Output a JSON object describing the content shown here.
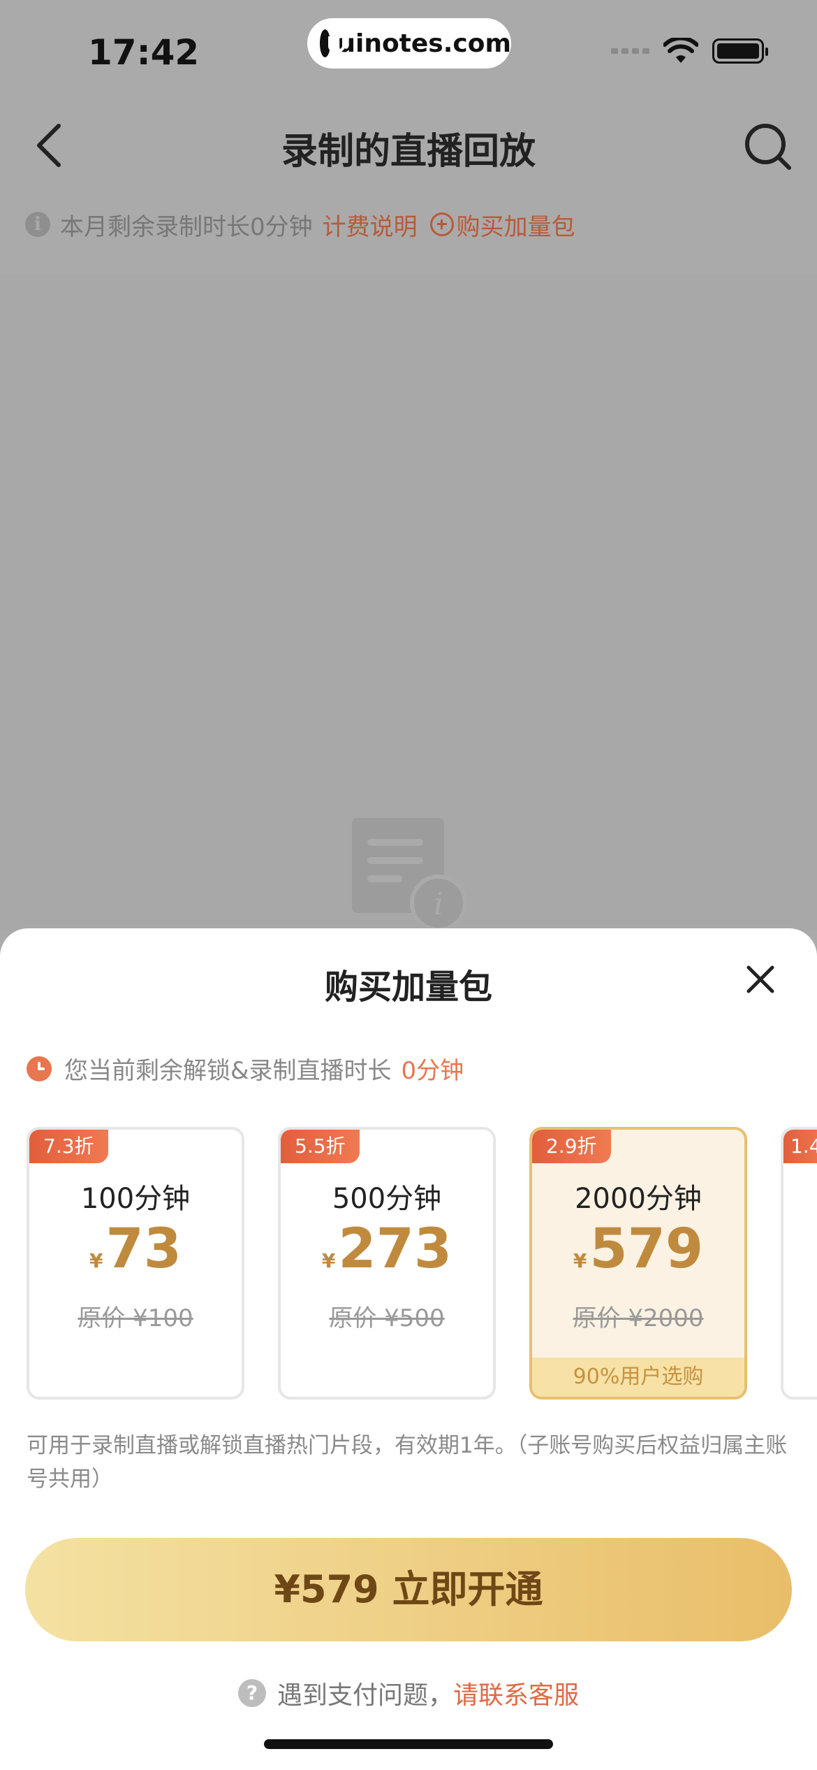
{
  "status_bar": {
    "time": "17:42",
    "watermark": "uinotes.com",
    "icons": [
      "signal-icon",
      "wifi-icon",
      "battery-icon"
    ]
  },
  "nav": {
    "title": "录制的直播回放",
    "back_icon": "chevron-left-icon",
    "search_icon": "search-icon"
  },
  "info": {
    "remaining_text": "本月剩余录制时长0分钟",
    "billing_link": "计费说明",
    "buy_link": "购买加量包"
  },
  "sheet": {
    "title": "购买加量包",
    "remaining_label": "您当前剩余解锁&录制直播时长",
    "remaining_value": "0分钟",
    "packages": [
      {
        "badge": "7.3折",
        "minutes": "100分钟",
        "currency": "¥",
        "price": "73",
        "original": "原价 ¥100",
        "selected": false
      },
      {
        "badge": "5.5折",
        "minutes": "500分钟",
        "currency": "¥",
        "price": "273",
        "original": "原价 ¥500",
        "selected": false
      },
      {
        "badge": "2.9折",
        "minutes": "2000分钟",
        "currency": "¥",
        "price": "579",
        "original": "原价 ¥2000",
        "selected": true,
        "tag": "90%用户选购"
      },
      {
        "badge": "1.4",
        "minutes": "",
        "currency": "",
        "price": "",
        "original": "",
        "selected": false
      }
    ],
    "description": "可用于录制直播或解锁直播热门片段，有效期1年。（子账号购买后权益归属主账号共用）",
    "cta_label": "¥579 立即开通",
    "help_text": "遇到支付问题，",
    "help_link": "请联系客服"
  },
  "colors": {
    "accent_orange": "#e8764e",
    "gold_text": "#c08a3e",
    "cta_gradient_start": "#f4e1a2",
    "cta_gradient_end": "#e9be6a",
    "overlay_gray": "#aaaaaa"
  }
}
